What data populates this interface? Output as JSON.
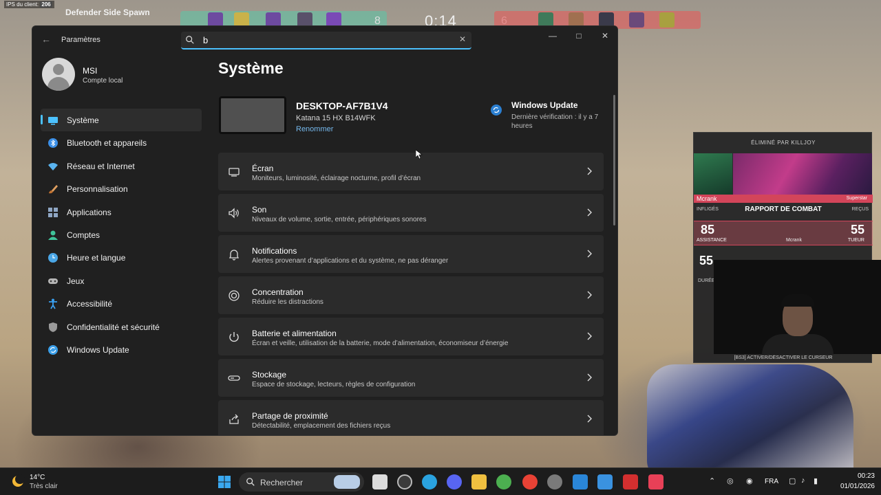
{
  "game": {
    "fps_label": "IPS du client:",
    "fps_value": "206",
    "spawn_label": "Defender Side Spawn",
    "score_left": "8",
    "timer": "0:14",
    "score_right": "6"
  },
  "settings": {
    "app_title": "Paramètres",
    "search_value": "b",
    "user": {
      "name": "MSI",
      "account_type": "Compte local"
    },
    "nav": [
      {
        "label": "Système",
        "icon": "system-icon",
        "color": "#4cc2ff",
        "active": true
      },
      {
        "label": "Bluetooth et appareils",
        "icon": "bluetooth-icon",
        "color": "#3a8ee6"
      },
      {
        "label": "Réseau et Internet",
        "icon": "wifi-icon",
        "color": "#5ab4f0"
      },
      {
        "label": "Personnalisation",
        "icon": "brush-icon",
        "color": "#e0a060"
      },
      {
        "label": "Applications",
        "icon": "apps-icon",
        "color": "#8fa6c4"
      },
      {
        "label": "Comptes",
        "icon": "account-icon",
        "color": "#3fc49a"
      },
      {
        "label": "Heure et langue",
        "icon": "globe-clock-icon",
        "color": "#4aa6e6"
      },
      {
        "label": "Jeux",
        "icon": "gamepad-icon",
        "color": "#b6b6b6"
      },
      {
        "label": "Accessibilité",
        "icon": "accessibility-icon",
        "color": "#3aa0f0"
      },
      {
        "label": "Confidentialité et sécurité",
        "icon": "shield-icon",
        "color": "#9a9a9a"
      },
      {
        "label": "Windows Update",
        "icon": "windows-update-icon",
        "color": "#3a9ee8"
      }
    ],
    "page_title": "Système",
    "device": {
      "name": "DESKTOP-AF7B1V4",
      "model": "Katana 15 HX B14WFK",
      "rename": "Renommer"
    },
    "windows_update": {
      "title": "Windows Update",
      "subtitle": "Dernière vérification : il y a 7 heures"
    },
    "cards": [
      {
        "title": "Écran",
        "desc": "Moniteurs, luminosité, éclairage nocturne, profil d’écran",
        "icon": "display-icon"
      },
      {
        "title": "Son",
        "desc": "Niveaux de volume, sortie, entrée, périphériques sonores",
        "icon": "speaker-icon"
      },
      {
        "title": "Notifications",
        "desc": "Alertes provenant d’applications et du système, ne pas déranger",
        "icon": "bell-icon"
      },
      {
        "title": "Concentration",
        "desc": "Réduire les distractions",
        "icon": "focus-icon"
      },
      {
        "title": "Batterie et alimentation",
        "desc": "Écran et veille, utilisation de la batterie, mode d’alimentation, économiseur d’énergie",
        "icon": "power-icon"
      },
      {
        "title": "Stockage",
        "desc": "Espace de stockage, lecteurs, règles de configuration",
        "icon": "storage-icon"
      },
      {
        "title": "Partage de proximité",
        "desc": "Détectabilité, emplacement des fichiers reçus",
        "icon": "share-icon"
      }
    ]
  },
  "combat_report": {
    "header": "ÉLIMINÉ PAR KILLJOY",
    "player": "Mcrank",
    "player_title": "Superstar",
    "inflicted_label": "INFLIGÉS",
    "title": "RAPPORT DE COMBAT",
    "received_label": "REÇUS",
    "left_value": "85",
    "left_label": "ASSISTANCE",
    "right_value": "55",
    "right_label": "TUEUR",
    "middle_name": "Mcrank",
    "second_value": "55",
    "duration_label": "DURÉE",
    "footer": "[BS3] ACTIVER/DÉSACTIVER LE CURSEUR"
  },
  "taskbar": {
    "weather_temp": "14°C",
    "weather_desc": "Très clair",
    "search_label": "Rechercher",
    "language": "FRA",
    "time": "00:23",
    "date": "01/01/2026"
  }
}
